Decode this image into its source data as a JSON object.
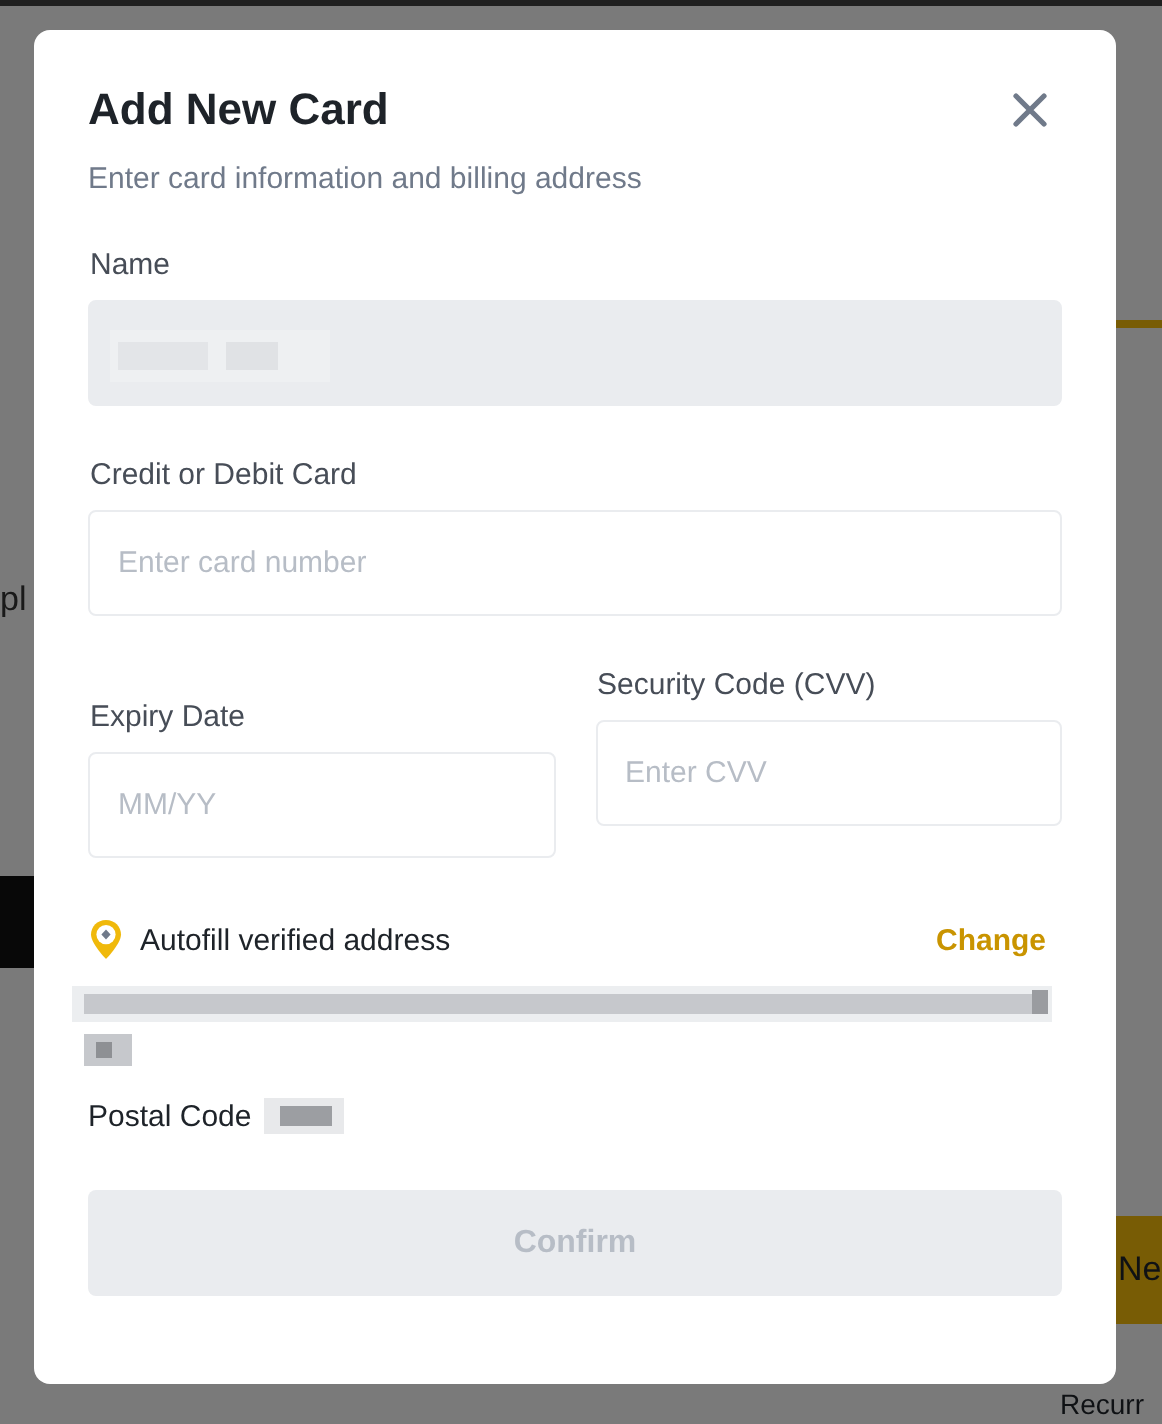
{
  "background": {
    "texts": [
      {
        "kind": "left",
        "text": "pl"
      },
      {
        "kind": "button",
        "text": "Ne"
      },
      {
        "kind": "link",
        "text": "Recurr"
      }
    ]
  },
  "dialog": {
    "title": "Add New Card",
    "subtitle": "Enter card information and billing address",
    "fields": [
      {
        "label": "Name",
        "disabled": true,
        "redacted": true
      },
      {
        "label": "Credit or Debit Card",
        "placeholder": "Enter card number",
        "disabled": false
      }
    ],
    "row_fields": [
      {
        "label": "Expiry Date",
        "placeholder": "MM/YY",
        "disabled": false
      },
      {
        "label": "Security Code (CVV)",
        "placeholder": "Enter CVV",
        "disabled": false
      }
    ],
    "address": {
      "label": "Autofill verified address",
      "change": "Change",
      "postal_label": "Postal Code"
    },
    "confirm": {
      "label": "Confirm",
      "disabled": true
    }
  }
}
